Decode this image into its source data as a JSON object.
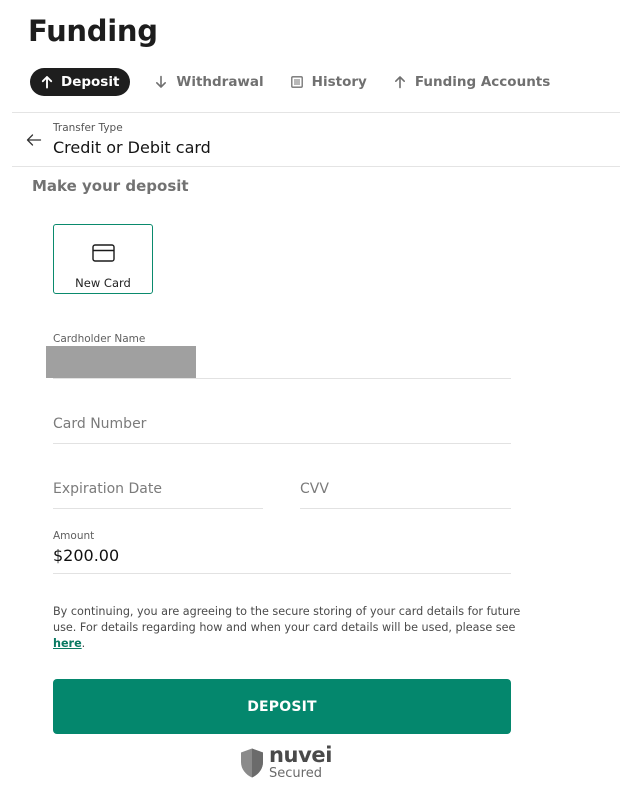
{
  "page": {
    "title": "Funding"
  },
  "tabs": [
    {
      "label": "Deposit",
      "icon": "arrow-up-icon",
      "active": true
    },
    {
      "label": "Withdrawal",
      "icon": "arrow-down-icon",
      "active": false
    },
    {
      "label": "History",
      "icon": "list-icon",
      "active": false
    },
    {
      "label": "Funding Accounts",
      "icon": "arrow-up-icon",
      "active": false
    }
  ],
  "transfer": {
    "label": "Transfer Type",
    "value": "Credit or Debit card"
  },
  "deposit_form": {
    "section_title": "Make your deposit",
    "new_card_label": "New Card",
    "cardholder_label": "Cardholder Name",
    "card_number_placeholder": "Card Number",
    "expiration_placeholder": "Expiration Date",
    "cvv_placeholder": "CVV",
    "amount_label": "Amount",
    "amount_value": "$200.00",
    "consent_text": "By continuing, you are agreeing to the secure storing of your card details for future use. For details regarding how and when your card details will be used, please see",
    "consent_link": "here",
    "consent_end": ".",
    "submit_label": "DEPOSIT"
  },
  "footer": {
    "brand": "nuvei",
    "sub": "Secured"
  },
  "colors": {
    "accent": "#04876d",
    "active_tab": "#1e1e1e",
    "redaction": "#a0a0a0"
  }
}
